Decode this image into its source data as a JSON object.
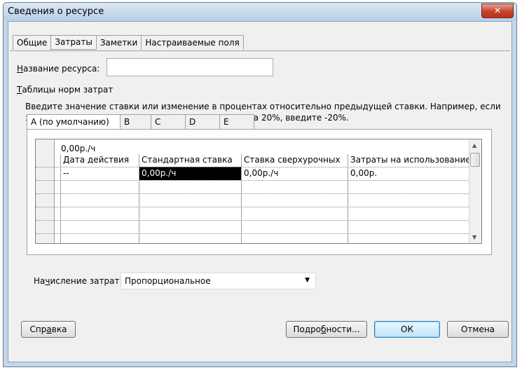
{
  "window": {
    "title": "Сведения о ресурсе",
    "close_glyph": "✕"
  },
  "tabs": [
    {
      "label": "Общие"
    },
    {
      "label": "Затраты"
    },
    {
      "label": "Заметки"
    },
    {
      "label": "Настраиваемые поля"
    }
  ],
  "active_tab": "Затраты",
  "resource_name": {
    "label_prefix": "Н",
    "label_rest": "азвание ресурса:",
    "value": ""
  },
  "rates_group": {
    "label_prefix": "Т",
    "label_rest": "аблицы норм затрат",
    "hint_line1": "Введите значение ставки или изменение в процентах относительно предыдущей ставки. Например, если",
    "hint_line2": "затраты на использование ресурса сокращаются на 20%, введите -20%."
  },
  "rate_tabs": [
    {
      "label": "А (по умолчанию)"
    },
    {
      "label": "В"
    },
    {
      "label": "С"
    },
    {
      "label": "D"
    },
    {
      "label": "E"
    }
  ],
  "grid": {
    "edit_value": "0,00р./ч",
    "headers": [
      "Дата действия",
      "Стандартная ставка",
      "Ставка сверхурочных",
      "Затраты на использование"
    ],
    "rows": [
      [
        "--",
        "0,00р./ч",
        "0,00р./ч",
        "0,00р."
      ]
    ],
    "selected_cell": "Стандартная ставка"
  },
  "accrual": {
    "label_before": "На",
    "label_u": "ч",
    "label_after": "исление затрат:",
    "value": "Пропорциональное"
  },
  "buttons": {
    "help_a": "Спр",
    "help_u": "а",
    "help_b": "вка",
    "details_a": "Подро",
    "details_u": "б",
    "details_b": "ности...",
    "ok": "ОК",
    "cancel": "Отмена"
  }
}
